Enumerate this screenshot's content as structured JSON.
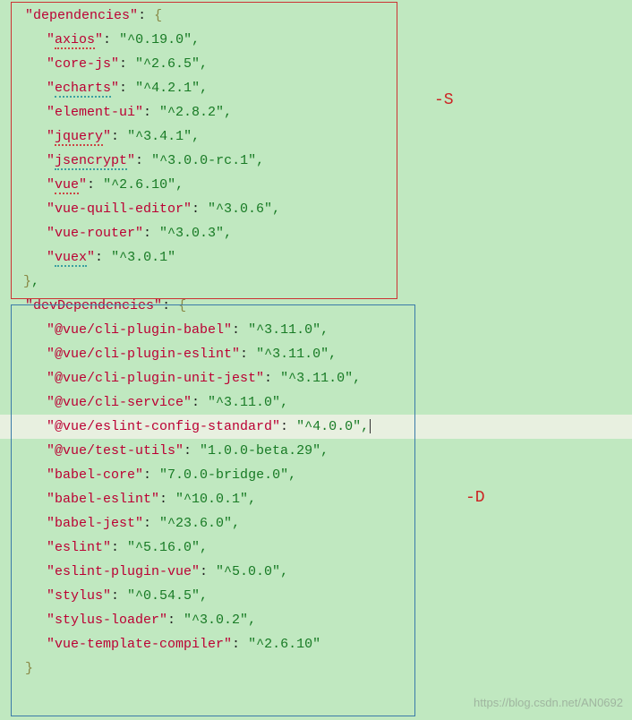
{
  "dependencies": {
    "label": "dependencies",
    "items": [
      {
        "key": "axios",
        "value": "^0.19.0",
        "squiggle": "red"
      },
      {
        "key": "core-js",
        "value": "^2.6.5"
      },
      {
        "key": "echarts",
        "value": "^4.2.1",
        "squiggle": "teal"
      },
      {
        "key": "element-ui",
        "value": "^2.8.2"
      },
      {
        "key": "jquery",
        "value": "^3.4.1",
        "squiggle": "red"
      },
      {
        "key": "jsencrypt",
        "value": "^3.0.0-rc.1",
        "squiggle": "teal"
      },
      {
        "key": "vue",
        "value": "^2.6.10",
        "squiggle": "red"
      },
      {
        "key": "vue-quill-editor",
        "value": "^3.0.6"
      },
      {
        "key": "vue-router",
        "value": "^3.0.3"
      },
      {
        "key": "vuex",
        "value": "^3.0.1",
        "squiggle": "teal"
      }
    ]
  },
  "devDependencies": {
    "label": "devDependencies",
    "items": [
      {
        "key": "@vue/cli-plugin-babel",
        "value": "^3.11.0"
      },
      {
        "key": "@vue/cli-plugin-eslint",
        "value": "^3.11.0"
      },
      {
        "key": "@vue/cli-plugin-unit-jest",
        "value": "^3.11.0"
      },
      {
        "key": "@vue/cli-service",
        "value": "^3.11.0"
      },
      {
        "key": "@vue/eslint-config-standard",
        "value": "^4.0.0",
        "highlight": true
      },
      {
        "key": "@vue/test-utils",
        "value": "1.0.0-beta.29"
      },
      {
        "key": "babel-core",
        "value": "7.0.0-bridge.0"
      },
      {
        "key": "babel-eslint",
        "value": "^10.0.1"
      },
      {
        "key": "babel-jest",
        "value": "^23.6.0"
      },
      {
        "key": "eslint",
        "value": "^5.16.0"
      },
      {
        "key": "eslint-plugin-vue",
        "value": "^5.0.0"
      },
      {
        "key": "stylus",
        "value": "^0.54.5"
      },
      {
        "key": "stylus-loader",
        "value": "^3.0.2"
      },
      {
        "key": "vue-template-compiler",
        "value": "^2.6.10"
      }
    ]
  },
  "annotations": {
    "s_label": "-S",
    "d_label": "-D"
  },
  "watermark": "https://blog.csdn.net/AN0692"
}
